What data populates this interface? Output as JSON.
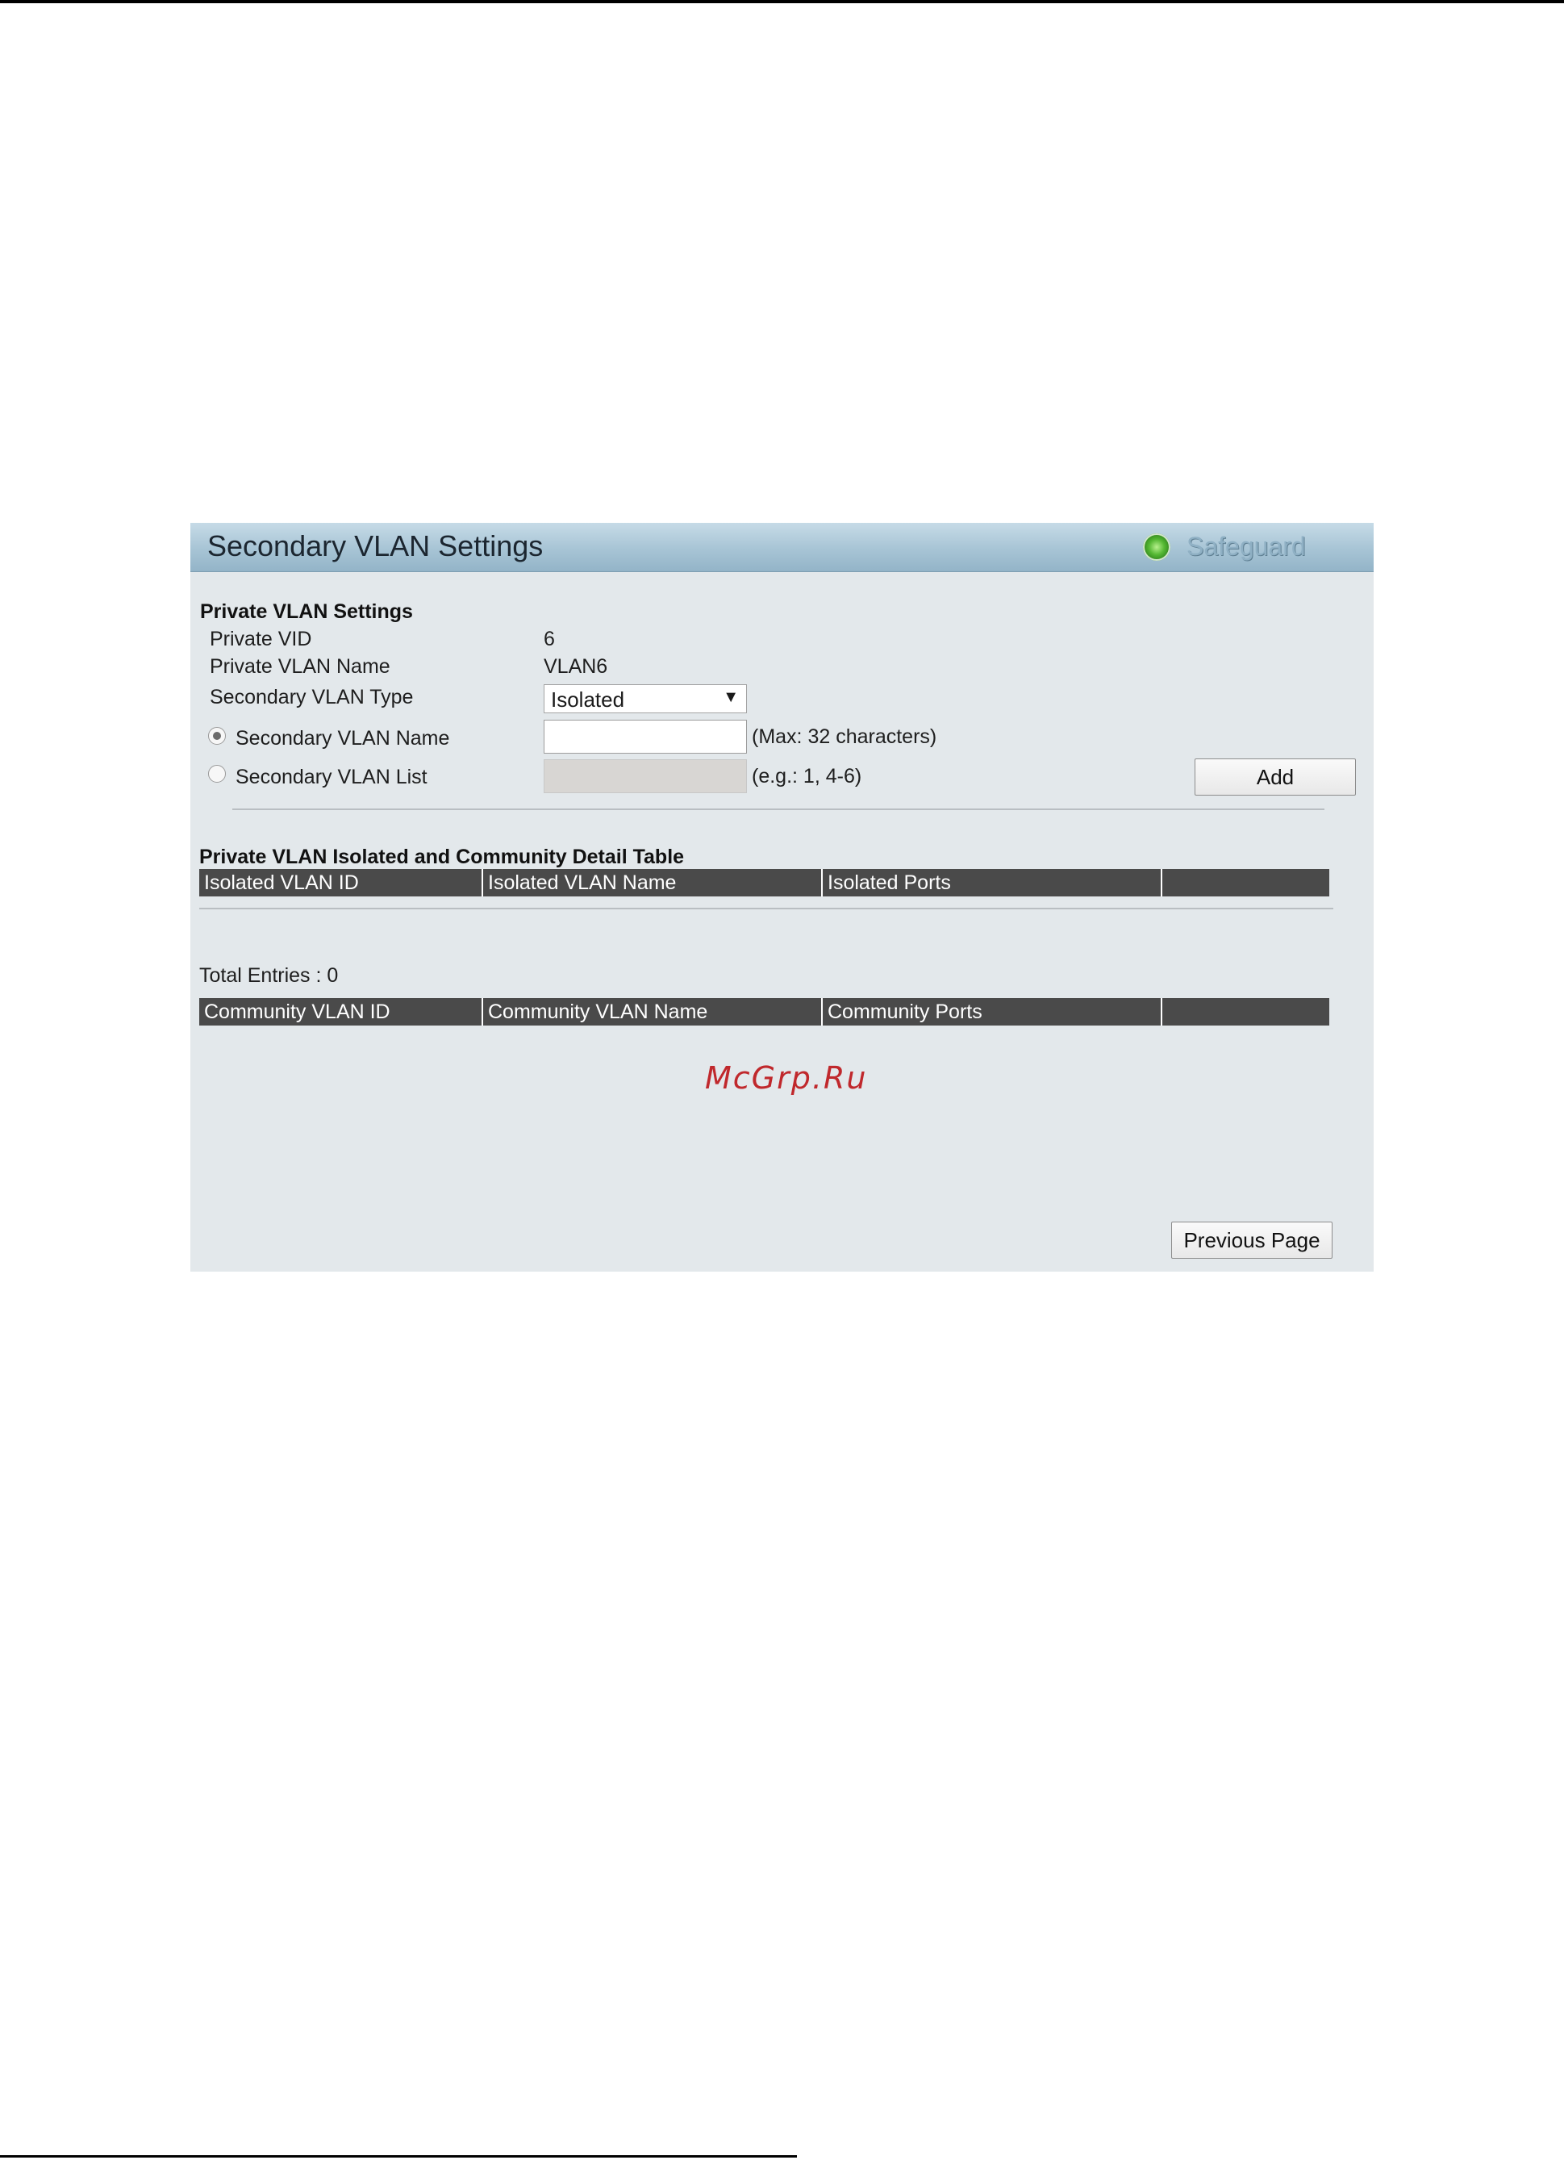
{
  "panel": {
    "title": "Secondary VLAN Settings",
    "status_label": "Safeguard",
    "status_icon": "status-led-green-icon"
  },
  "settings": {
    "section_title": "Private VLAN Settings",
    "private_vid_label": "Private VID",
    "private_vid_value": "6",
    "private_vlan_name_label": "Private VLAN Name",
    "private_vlan_name_value": "VLAN6",
    "secondary_type_label": "Secondary VLAN Type",
    "secondary_type_selected": "Isolated",
    "secondary_name_label": "Secondary VLAN Name",
    "secondary_name_value": "",
    "secondary_name_hint": "(Max: 32 characters)",
    "secondary_list_label": "Secondary VLAN List",
    "secondary_list_value": "",
    "secondary_list_hint": "(e.g.: 1, 4-6)",
    "selected_option": "Secondary VLAN Name",
    "add_button": "Add"
  },
  "detail_table": {
    "title": "Private VLAN Isolated and Community Detail Table",
    "isolated_columns": [
      "Isolated VLAN ID",
      "Isolated VLAN Name",
      "Isolated Ports",
      ""
    ],
    "total_entries": "Total Entries : 0",
    "community_columns": [
      "Community VLAN ID",
      "Community VLAN Name",
      "Community Ports",
      ""
    ]
  },
  "previous_page_button": "Previous Page",
  "watermark": "McGrp.Ru",
  "colors": {
    "header_gradient_top": "#c6dbe7",
    "header_gradient_bottom": "#93b4c8",
    "panel_background": "#e3e8eb",
    "table_header_background": "#4a4a4a",
    "watermark": "#c0282c"
  }
}
